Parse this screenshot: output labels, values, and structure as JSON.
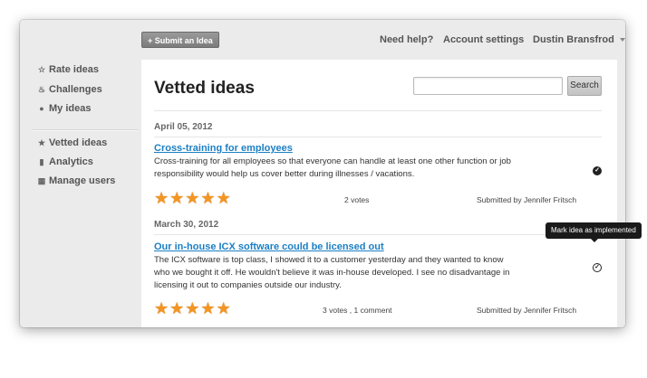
{
  "header": {
    "submit_label": "+ Submit an Idea",
    "help_label": "Need help?",
    "settings_label": "Account settings",
    "user_name": "Dustin Bransfrod"
  },
  "sidebar": {
    "items": [
      {
        "label": "Rate ideas",
        "icon": "star-icon",
        "glyph": "☆"
      },
      {
        "label": "Challenges",
        "icon": "fire-icon",
        "glyph": "♨"
      },
      {
        "label": "My ideas",
        "icon": "user-icon",
        "glyph": "●"
      },
      {
        "label": "Vetted ideas",
        "icon": "star-filled-icon",
        "glyph": "★"
      },
      {
        "label": "Analytics",
        "icon": "bar-chart-icon",
        "glyph": "▮"
      },
      {
        "label": "Manage users",
        "icon": "grid-icon",
        "glyph": "▦"
      }
    ]
  },
  "main": {
    "title": "Vetted ideas",
    "search_placeholder": "",
    "search_button": "Search",
    "ideas": [
      {
        "date": "April 05, 2012",
        "title": "Cross-training for employees",
        "body": "Cross-training for all employees so that everyone can handle at least one other function or job responsibility would help us cover better during illnesses / vacations.",
        "rating": 5,
        "votes": "2 votes",
        "submitted": "Submitted by Jennifer Fritsch",
        "status_icon": "check-circle-filled-icon"
      },
      {
        "date": "March 30, 2012",
        "title": "Our in-house ICX software could be licensed out",
        "body": "The ICX software is top class, I showed it to a customer yesterday and they wanted to know who we bought it off. He wouldn't believe it was in-house developed. I see no disadvantage in licensing it out to companies outside our industry.",
        "rating": 5,
        "votes": "3 votes , 1 comment",
        "submitted": "Submitted by Jennifer Fritsch",
        "status_icon": "check-circle-outline-icon"
      }
    ]
  },
  "tooltip": {
    "text": "Mark idea as implemented"
  },
  "colors": {
    "link": "#1b7fc4",
    "star": "#f39522",
    "window_bg": "#ebebeb"
  }
}
